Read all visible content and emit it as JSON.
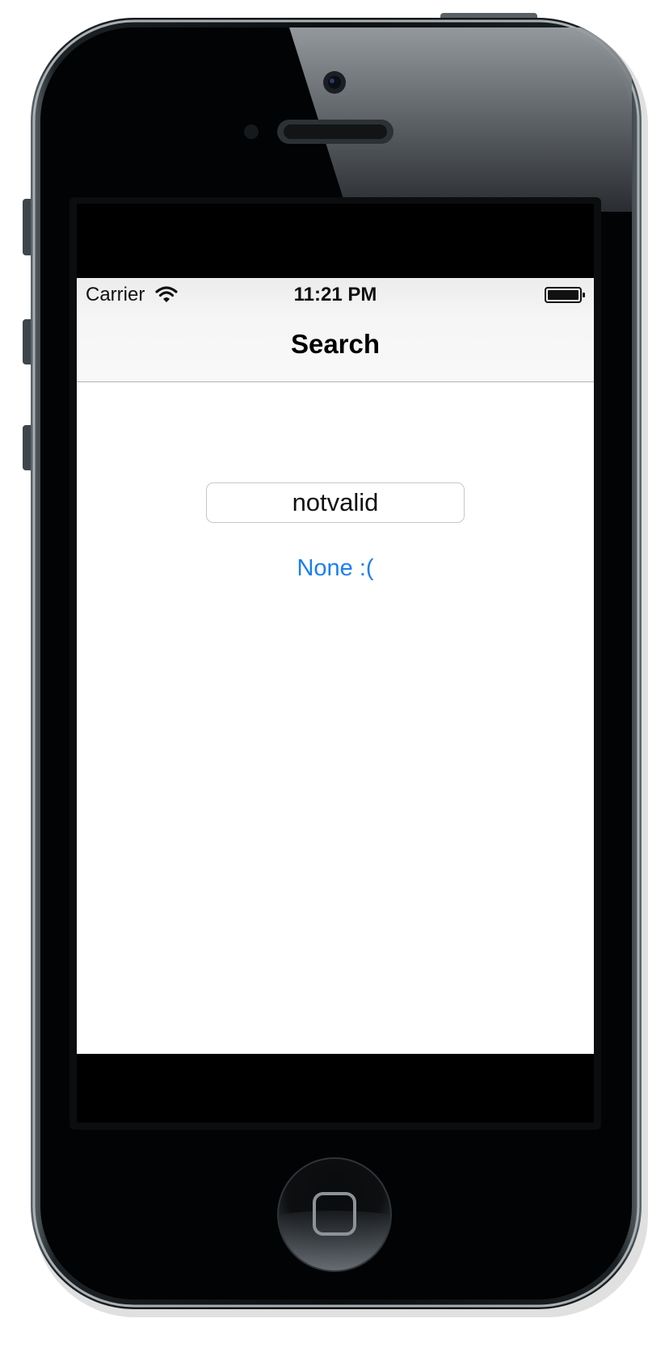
{
  "status_bar": {
    "carrier": "Carrier",
    "time": "11:21 PM",
    "wifi_icon": "wifi-icon",
    "battery_icon": "battery-full-icon"
  },
  "nav_bar": {
    "title": "Search"
  },
  "search": {
    "value": "notvalid",
    "placeholder": ""
  },
  "result": {
    "text": "None :(",
    "color": "#1a7ff2"
  },
  "device": {
    "home_button_icon": "home-button-icon",
    "camera_icon": "front-camera-icon",
    "speaker_icon": "earpiece-speaker-icon"
  }
}
